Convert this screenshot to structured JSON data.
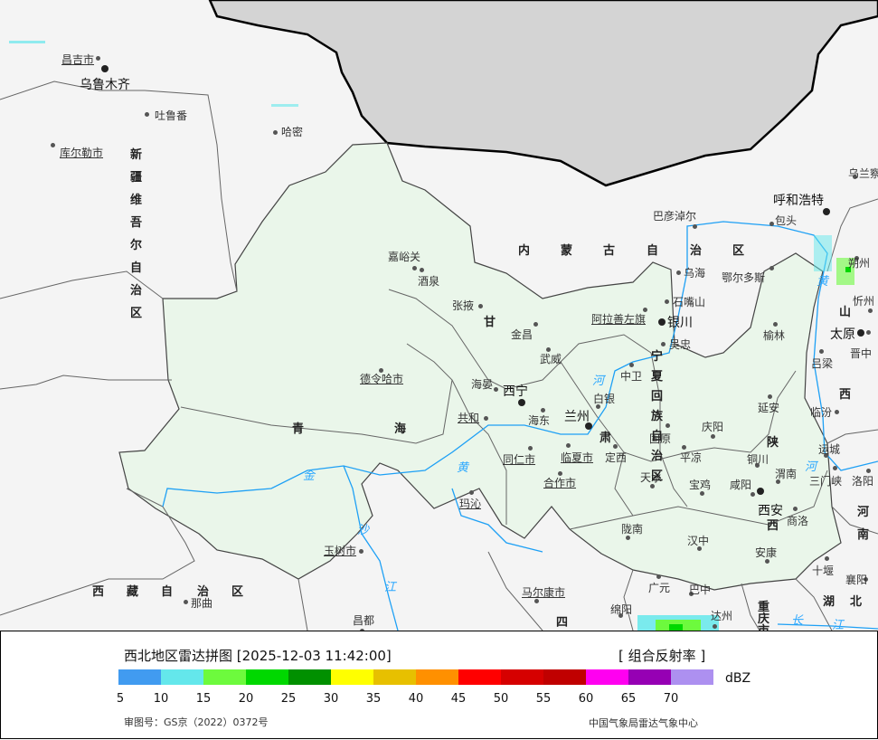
{
  "header": {
    "title": "西北地区雷达拼图 [2025-12-03 11:42:00]",
    "product": "[ 组合反射率 ]"
  },
  "legend": {
    "unit": "dBZ",
    "ticks": [
      "5",
      "10",
      "15",
      "20",
      "25",
      "30",
      "35",
      "40",
      "45",
      "50",
      "55",
      "60",
      "65",
      "70"
    ],
    "colors": [
      "#419bf0",
      "#64e7eb",
      "#6dfa3d",
      "#00d800",
      "#019000",
      "#ffff00",
      "#e7c000",
      "#ff9000",
      "#ff0000",
      "#d60000",
      "#c00000",
      "#ff00f0",
      "#9600b4",
      "#ad90f0"
    ]
  },
  "footer": {
    "approval": "审图号：GS京（2022）0372号",
    "source": "中国气象局雷达气象中心"
  },
  "map": {
    "colors": {
      "region": "#eaf6ea",
      "outside": "#f4f4f4",
      "foreign": "#d3d3d3",
      "river": "#1ea0f5"
    },
    "cities": [
      "昌吉市",
      "乌鲁木齐",
      "吐鲁番",
      "哈密",
      "库尔勒市",
      "嘉峪关",
      "酒泉",
      "张掖",
      "金昌",
      "武威",
      "德令哈市",
      "海晏",
      "西宁",
      "共和",
      "海东",
      "兰州",
      "白银",
      "中卫",
      "临夏市",
      "定西",
      "同仁市",
      "合作市",
      "玛沁",
      "玉树市",
      "那曲",
      "昌都",
      "马尔康市",
      "绵阳",
      "广元",
      "巴中",
      "达州",
      "陇南",
      "天水",
      "宝鸡",
      "平凉",
      "庆阳",
      "固原",
      "吴忠",
      "银川",
      "石嘴山",
      "乌海",
      "阿拉善左旗",
      "巴彦淖尔",
      "包头",
      "呼和浩特",
      "鄂尔多斯",
      "榆林",
      "延安",
      "咸阳",
      "铜川",
      "渭南",
      "西安",
      "商洛",
      "安康",
      "汉中",
      "十堰",
      "襄阳",
      "三门峡",
      "洛阳",
      "运城",
      "临汾",
      "吕梁",
      "晋中",
      "太原",
      "忻州",
      "朔州",
      "乌兰察布"
    ],
    "provinces": [
      "新",
      "疆",
      "维",
      "吾",
      "尔",
      "自",
      "治",
      "区",
      "内",
      "蒙",
      "古",
      "自",
      "治",
      "区",
      "青",
      "海",
      "甘",
      "肃",
      "宁",
      "夏",
      "回",
      "族",
      "自",
      "治",
      "区",
      "陕",
      "西",
      "山",
      "西",
      "西",
      "藏",
      "自",
      "治",
      "区",
      "四",
      "河",
      "南",
      "湖",
      "北",
      "重",
      "庆",
      "市"
    ],
    "rivers": [
      "黄",
      "河",
      "黄",
      "河",
      "金",
      "沙",
      "江",
      "长",
      "江"
    ]
  }
}
